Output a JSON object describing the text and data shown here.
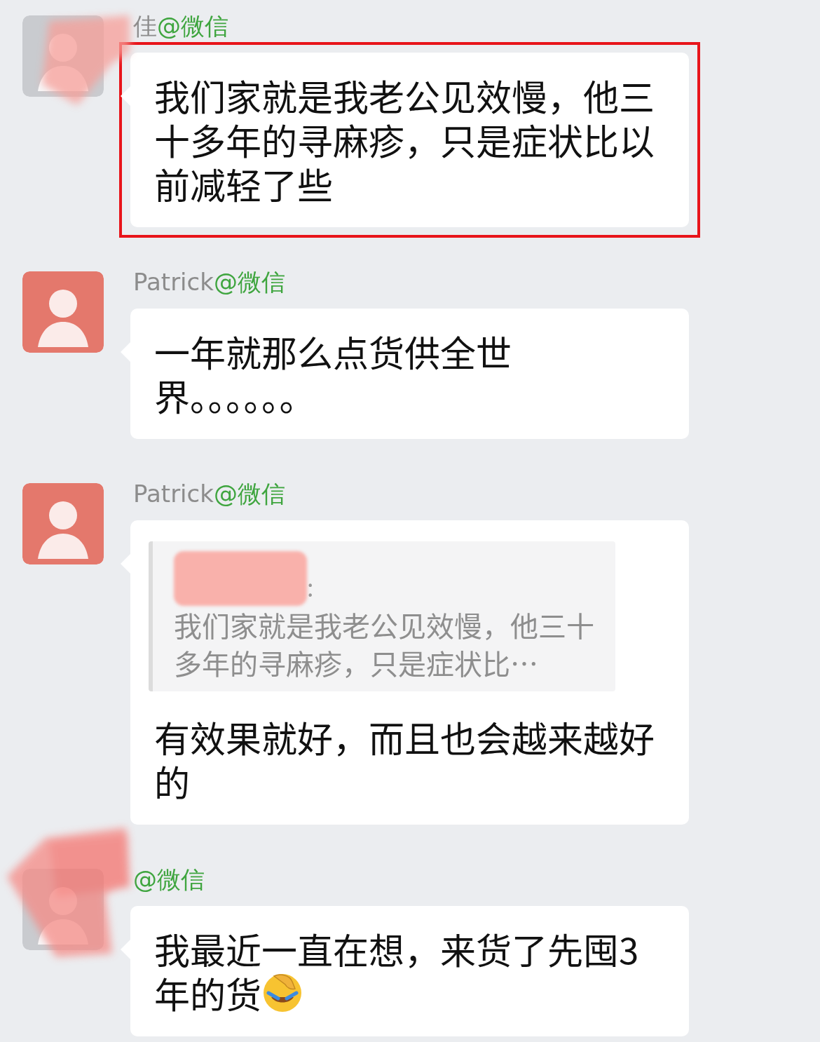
{
  "messages": [
    {
      "sender": {
        "name": "佳",
        "suffix": "@微信"
      },
      "avatar": {
        "color": "#c9cbcf"
      },
      "highlighted": true,
      "text": "我们家就是我老公见效慢，他三十多年的寻麻疹，只是症状比以前减轻了些"
    },
    {
      "sender": {
        "name": "Patrick",
        "suffix": "@微信"
      },
      "avatar": {
        "color": "#e4786c"
      },
      "highlighted": false,
      "text": "一年就那么点货供全世界。。。。。。"
    },
    {
      "sender": {
        "name": "Patrick",
        "suffix": "@微信"
      },
      "avatar": {
        "color": "#e4786c"
      },
      "highlighted": false,
      "quote": {
        "separator": ":",
        "text": "我们家就是我老公见效慢，他三十多年的寻麻疹，只是症状比…"
      },
      "text": "有效果就好，而且也会越来越好的"
    },
    {
      "sender": {
        "suffix": "@微信"
      },
      "avatar": {
        "color": "#c9cbcf"
      },
      "highlighted": false,
      "text": "我最近一直在想，来货了先囤3年的货",
      "emoji": true
    }
  ]
}
